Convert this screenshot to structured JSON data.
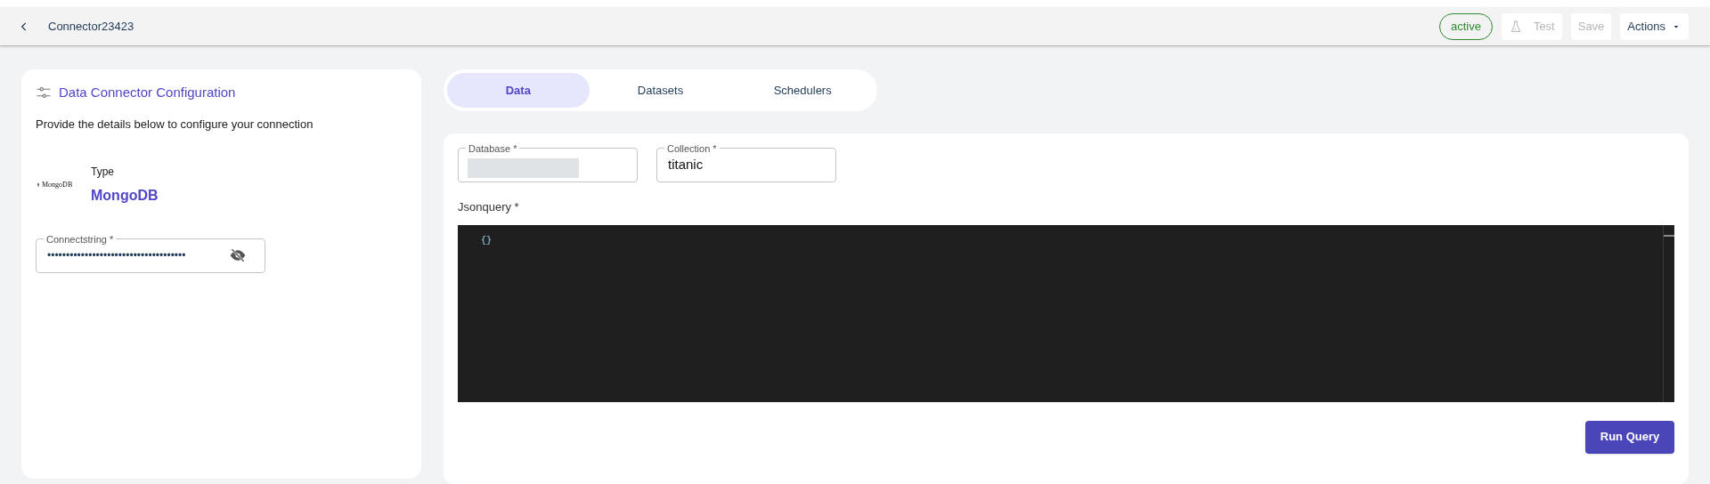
{
  "header": {
    "title": "Connector23423",
    "status": "active",
    "buttons": [
      {
        "label": "Test",
        "kind": "test",
        "disabled": true
      },
      {
        "label": "Save",
        "kind": "plain",
        "disabled": true
      },
      {
        "label": "Actions",
        "kind": "menu",
        "disabled": false
      }
    ]
  },
  "config_panel": {
    "title": "Data Connector Configuration",
    "description": "Provide the details below to configure your connection",
    "logo_text": "MongoDB",
    "type_label": "Type",
    "type_value": "MongoDB",
    "connectstring": {
      "label": "Connectstring *",
      "value": "•••••••••••••••••••••••••••••••••••••",
      "masked": true
    }
  },
  "tabs": [
    {
      "label": "Data",
      "selected": true
    },
    {
      "label": "Datasets",
      "selected": false
    },
    {
      "label": "Schedulers",
      "selected": false
    }
  ],
  "query_panel": {
    "database": {
      "label": "Database *",
      "redacted": true
    },
    "collection": {
      "label": "Collection *",
      "value": "titanic"
    },
    "jsonquery_label": "Jsonquery *",
    "editor_text": "{}",
    "run_button": "Run Query"
  }
}
